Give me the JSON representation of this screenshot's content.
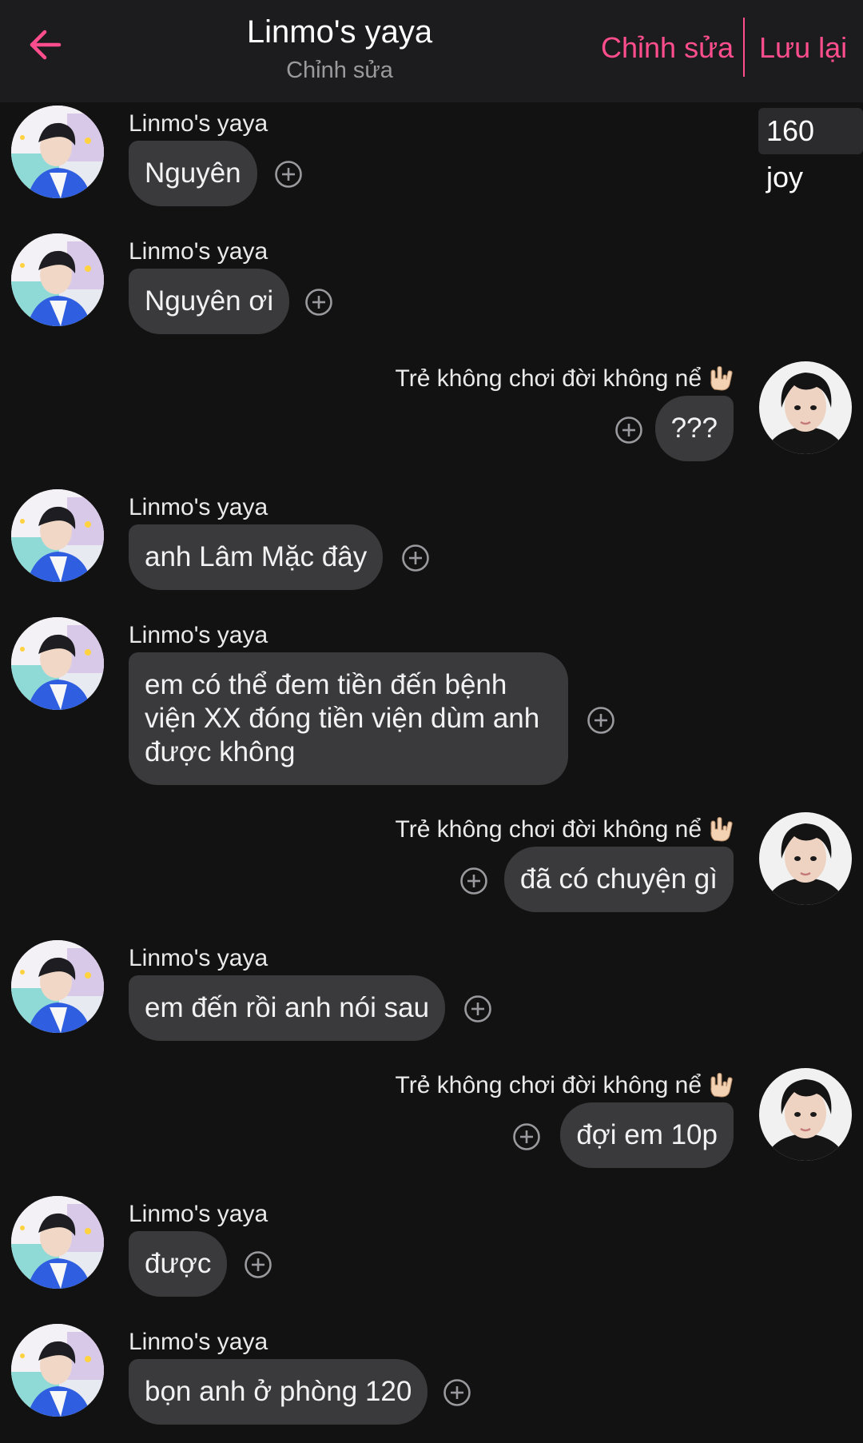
{
  "header": {
    "title": "Linmo's yaya",
    "subtitle": "Chỉnh sửa",
    "edit_label": "Chỉnh sửa",
    "save_label": "Lưu lại"
  },
  "joy_badge": "160 joy",
  "colors": {
    "accent": "#ff4d8d",
    "bubble": "#3a3a3c",
    "background": "#121212",
    "header": "#1c1c1e"
  },
  "contact_name": "Linmo's yaya",
  "me_name": "Trẻ không chơi đời không nể",
  "messages": [
    {
      "side": "left",
      "sender": "Linmo's yaya",
      "text": "Nguyên"
    },
    {
      "side": "left",
      "sender": "Linmo's yaya",
      "text": "Nguyên ơi"
    },
    {
      "side": "right",
      "sender": "Trẻ không chơi đời không nể",
      "text": "???"
    },
    {
      "side": "left",
      "sender": "Linmo's yaya",
      "text": "anh Lâm Mặc đây"
    },
    {
      "side": "left",
      "sender": "Linmo's yaya",
      "lines": [
        "em có thể đem tiền đến bệnh",
        "viện XX đóng tiền viện dùm anh",
        "được không"
      ]
    },
    {
      "side": "right",
      "sender": "Trẻ không chơi đời không nể",
      "text": "đã có chuyện gì"
    },
    {
      "side": "left",
      "sender": "Linmo's yaya",
      "text": "em đến rồi anh nói sau"
    },
    {
      "side": "right",
      "sender": "Trẻ không chơi đời không nể",
      "text": "đợi em 10p"
    },
    {
      "side": "left",
      "sender": "Linmo's yaya",
      "text": "được"
    },
    {
      "side": "left",
      "sender": "Linmo's yaya",
      "text": "bọn anh ở phòng 120"
    }
  ],
  "icons": {
    "back": "arrow-left-icon",
    "add": "plus-circle-icon",
    "sender_emoji": "love-you-hand-icon"
  }
}
